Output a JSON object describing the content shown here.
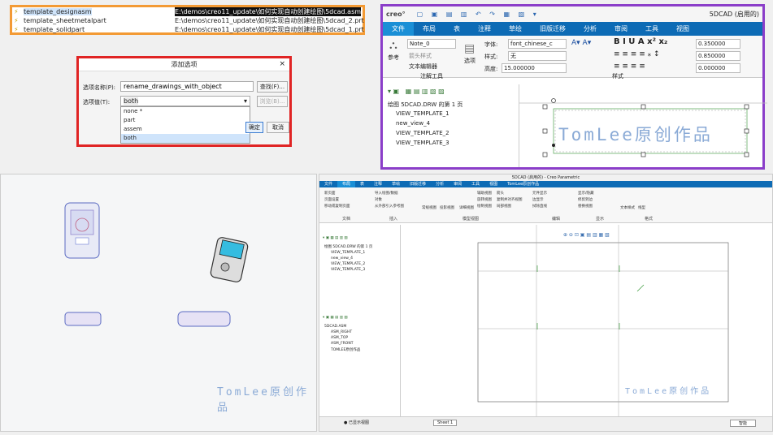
{
  "file_list": {
    "rows": [
      {
        "name": "template_designasm",
        "path": "E:\\demos\\creo11_update\\如何实现自动创建绘图\\5dcad.asm",
        "selected": true
      },
      {
        "name": "template_sheetmetalpart",
        "path": "E:\\demos\\creo11_update\\如何实现自动创建绘图\\5dcad_2.prt",
        "selected": false
      },
      {
        "name": "template_solidpart",
        "path": "E:\\demos\\creo11_update\\如何实现自动创建绘图\\5dcad_1.prt",
        "selected": false
      }
    ]
  },
  "dialog": {
    "title": "添加选项",
    "close": "×",
    "name_label": "选项名称(P):",
    "name_value": "rename_drawings_with_object",
    "find_button": "查找(F)...",
    "value_label": "选项值(T):",
    "value_value": "both",
    "browse_button": "浏览(B)...",
    "ok_button": "确定",
    "cancel_button": "取消",
    "options": [
      "none *",
      "part",
      "assem",
      "both"
    ],
    "selected_option": "both"
  },
  "creo": {
    "logo": "creo°",
    "window_title": "5DCAD (启用的)",
    "tabs": [
      "文件",
      "布局",
      "表",
      "注释",
      "草绘",
      "旧版迁移",
      "分析",
      "审阅",
      "工具",
      "视图"
    ],
    "active_tab": "文件",
    "note_field": "Note_0",
    "arrow_style": "箭头样式",
    "text_editor": "文本编辑器",
    "ref": "参考",
    "select": "选项",
    "group_annotate": "注解工具",
    "font_label": "字体:",
    "font_value": "font_chinese_c",
    "style_label": "样式:",
    "style_value": "无",
    "height_label": "高度:",
    "height_value": "15.000000",
    "group_style": "样式",
    "val1": "0.350000",
    "val2": "0.850000",
    "val3": "0.000000",
    "tree_header": "绘图 5DCAD.DRW 的第 1 页",
    "tree_items": [
      "VIEW_TEMPLATE_1",
      "new_view_4",
      "VIEW_TEMPLATE_2",
      "VIEW_TEMPLATE_3"
    ],
    "canvas_text": "TomLee原创作品"
  },
  "model": {
    "watermark": "TomLee原创作品"
  },
  "shot": {
    "title": "5DCAD (启用的) - Creo Parametric",
    "tabs": [
      "文件",
      "布局",
      "表",
      "注释",
      "草绘",
      "旧版迁移",
      "分析",
      "审阅",
      "工具",
      "视图",
      "TomLee原创作品"
    ],
    "active_tab": "布局",
    "group_labels": [
      "文档",
      "插入",
      "模型视图",
      "编辑",
      "显示",
      "格式"
    ],
    "buttons": [
      "新页面",
      "页面设置",
      "移动或复制页面",
      "导入绘图/数据",
      "对象",
      "从外部引入参考图",
      "常规视图",
      "投影视图",
      "详细视图",
      "辅助视图",
      "旋转视图",
      "箭头",
      "复制并对齐视图",
      "局部视图",
      "绘制视图",
      "元件显示",
      "边显示",
      "拭除直线",
      "显示/隐藏",
      "修剪到边",
      "替换视图",
      "文本样式",
      "线型"
    ],
    "drawing_tree_header": "绘图 5DCAD.DRW 的第 1 页",
    "drawing_tree": [
      "VIEW_TEMPLATE_1",
      "new_view_4",
      "VIEW_TEMPLATE_2",
      "VIEW_TEMPLATE_3"
    ],
    "model_tree": [
      "5DCAD.ASM",
      "ASM_RIGHT",
      "ASM_TOP",
      "ASM_FRONT",
      "TOMLEE原创作品"
    ],
    "sheet_tab": "Sheet 1",
    "status_text": "● 已显示视图",
    "status_right": "智能",
    "watermark": "TomLee原创作品"
  }
}
